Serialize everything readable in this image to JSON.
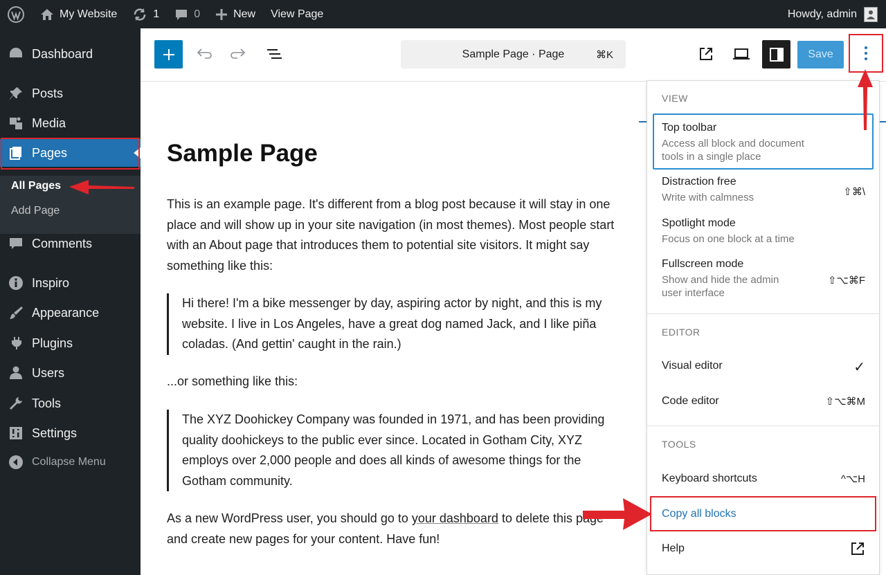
{
  "adminbar": {
    "site_name": "My Website",
    "updates_count": "1",
    "comments_count": "0",
    "new_label": "New",
    "view_page_label": "View Page",
    "howdy": "Howdy, admin"
  },
  "sidebar": {
    "items": [
      {
        "label": "Dashboard",
        "icon": "dashboard-icon"
      },
      {
        "label": "Posts",
        "icon": "pin-icon"
      },
      {
        "label": "Media",
        "icon": "media-icon"
      },
      {
        "label": "Pages",
        "icon": "pages-icon"
      },
      {
        "label": "Comments",
        "icon": "comment-icon"
      },
      {
        "label": "Inspiro",
        "icon": "info-icon"
      },
      {
        "label": "Appearance",
        "icon": "brush-icon"
      },
      {
        "label": "Plugins",
        "icon": "plugin-icon"
      },
      {
        "label": "Users",
        "icon": "user-icon"
      },
      {
        "label": "Tools",
        "icon": "wrench-icon"
      },
      {
        "label": "Settings",
        "icon": "settings-icon"
      }
    ],
    "submenu": {
      "all_pages": "All Pages",
      "add_page": "Add Page"
    },
    "collapse_label": "Collapse Menu"
  },
  "header": {
    "doc_title": "Sample Page · Page",
    "doc_shortcut": "⌘K",
    "save_label": "Save"
  },
  "content": {
    "title": "Sample Page",
    "para1": "This is an example page. It's different from a blog post because it will stay in one place and will show up in your site navigation (in most themes). Most people start with an About page that introduces them to potential site visitors. It might say something like this:",
    "quote1": "Hi there! I'm a bike messenger by day, aspiring actor by night, and this is my website. I live in Los Angeles, have a great dog named Jack, and I like piña coladas. (And gettin' caught in the rain.)",
    "para2": "...or something like this:",
    "quote2": "The XYZ Doohickey Company was founded in 1971, and has been providing quality doohickeys to the public ever since. Located in Gotham City, XYZ employs over 2,000 people and does all kinds of awesome things for the Gotham community.",
    "para3_before": "As a new WordPress user, you should go to ",
    "para3_link": "your dashboard",
    "para3_after": " to delete this page and create new pages for your content. Have fun!"
  },
  "menu": {
    "view_label": "VIEW",
    "top_toolbar": {
      "label": "Top toolbar",
      "desc": "Access all block and document tools in a single place"
    },
    "distraction_free": {
      "label": "Distraction free",
      "desc": "Write with calmness",
      "shortcut": "⇧⌘\\"
    },
    "spotlight": {
      "label": "Spotlight mode",
      "desc": "Focus on one block at a time"
    },
    "fullscreen": {
      "label": "Fullscreen mode",
      "desc": "Show and hide the admin user interface",
      "shortcut": "⇧⌥⌘F"
    },
    "editor_label": "EDITOR",
    "visual_editor": {
      "label": "Visual editor",
      "check": "✓"
    },
    "code_editor": {
      "label": "Code editor",
      "shortcut": "⇧⌥⌘M"
    },
    "tools_label": "TOOLS",
    "keyboard_shortcuts": {
      "label": "Keyboard shortcuts",
      "shortcut": "^⌥H"
    },
    "copy_all_blocks": {
      "label": "Copy all blocks"
    },
    "help": {
      "label": "Help"
    }
  },
  "colors": {
    "admin_dark": "#1d2327",
    "accent_blue": "#2271b1",
    "annotation_red": "#e0242b"
  }
}
